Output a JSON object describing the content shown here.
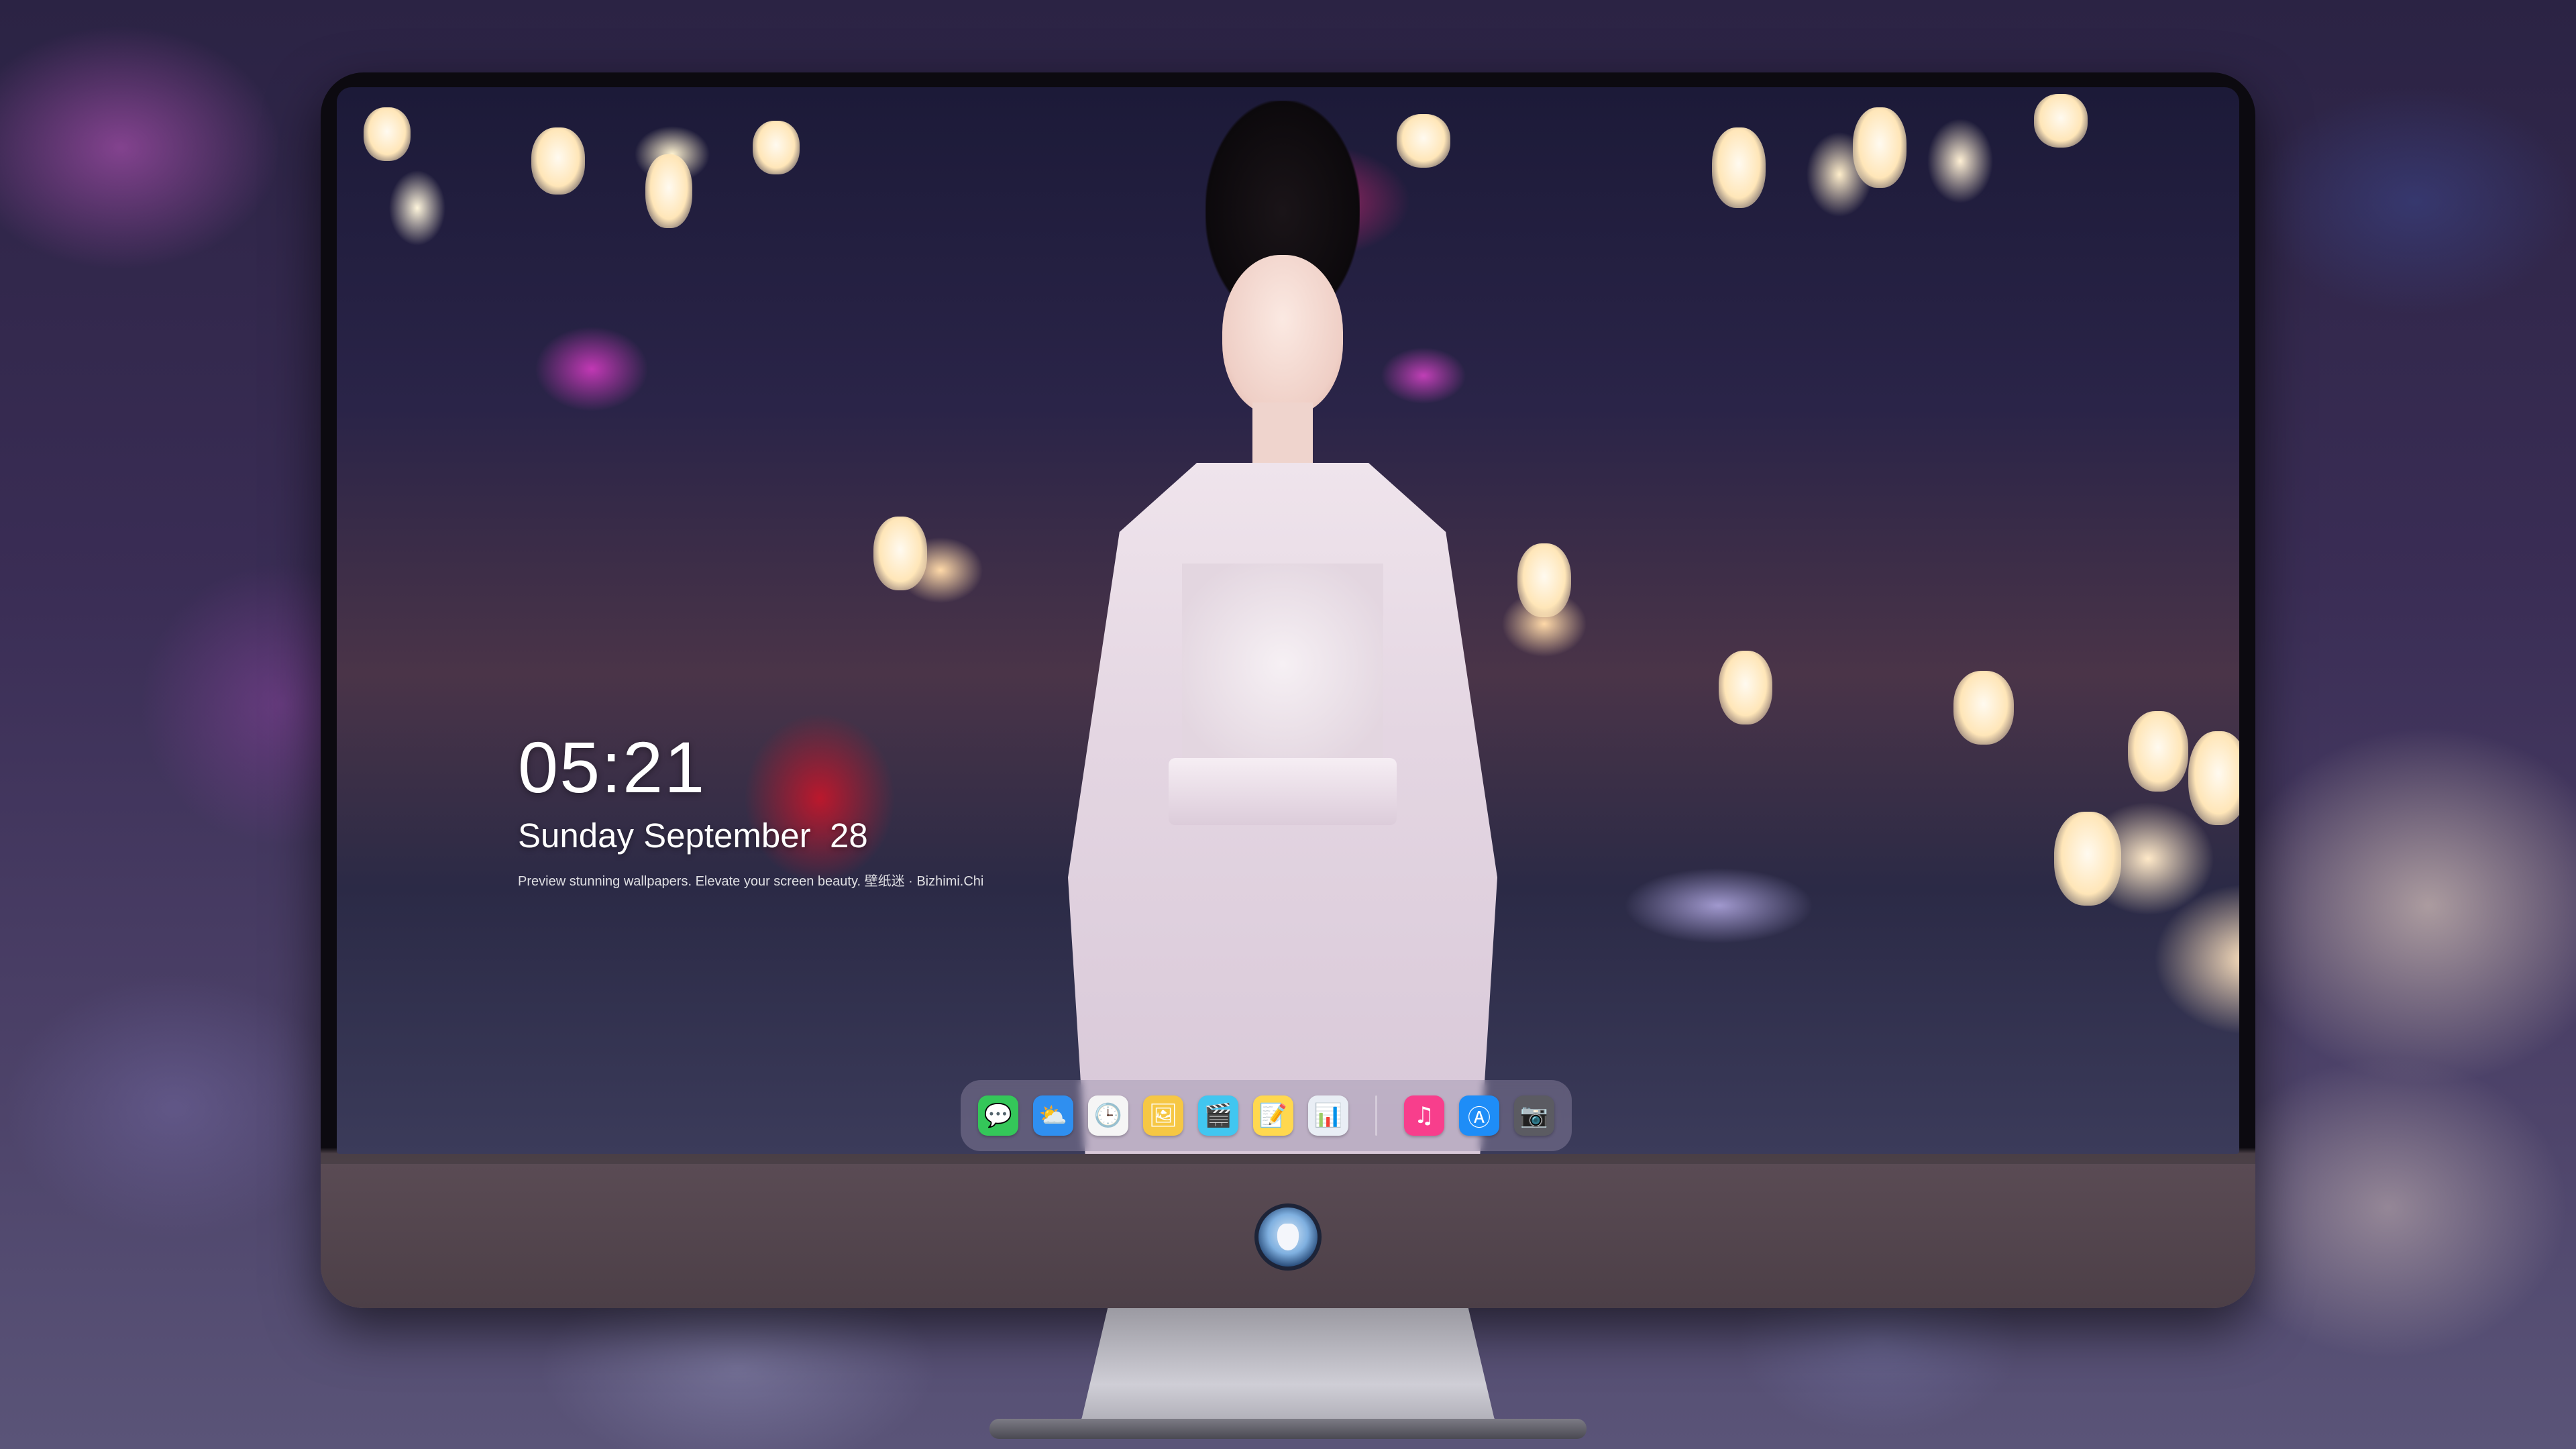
{
  "lock_screen": {
    "time": "05:21",
    "date": "Sunday September  28",
    "caption": "Preview stunning wallpapers. Elevate your screen beauty. 壁纸迷 · Bizhimi.Chi"
  },
  "dock": {
    "apps": [
      {
        "id": "messages",
        "icon": "messages-icon",
        "glyph": "💬",
        "color": "#34c759"
      },
      {
        "id": "weather",
        "icon": "weather-icon",
        "glyph": "⛅",
        "color": "#2f8ff0"
      },
      {
        "id": "clock",
        "icon": "clock-icon",
        "glyph": "🕒",
        "color": "#f5f5f5"
      },
      {
        "id": "preview",
        "icon": "preview-icon",
        "glyph": "🖼",
        "color": "#f6c744"
      },
      {
        "id": "clips",
        "icon": "clips-icon",
        "glyph": "🎬",
        "color": "#41c6f0"
      },
      {
        "id": "notes",
        "icon": "notes-icon",
        "glyph": "📝",
        "color": "#ffd84f"
      },
      {
        "id": "photos",
        "icon": "photo-gallery-icon",
        "glyph": "📊",
        "color": "#e9eef5"
      },
      {
        "id": "music",
        "icon": "music-icon",
        "glyph": "♫",
        "color": "#f83e8c"
      },
      {
        "id": "app-store",
        "icon": "app-store-icon",
        "glyph": "Ⓐ",
        "color": "#1e8df7"
      },
      {
        "id": "camera",
        "icon": "camera-icon",
        "glyph": "📷",
        "color": "#5b5b62"
      }
    ]
  }
}
